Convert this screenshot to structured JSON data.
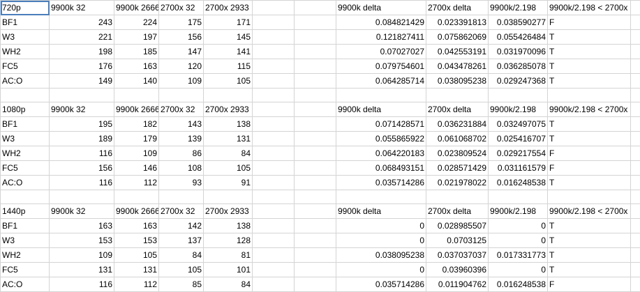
{
  "sheet": {
    "rows": [
      [
        "720p",
        "9900k 32",
        "9900k 2666",
        "2700x 32",
        "2700x 2933",
        "",
        "",
        "9900k delta",
        "2700x delta",
        "9900k/2.198",
        "9900k/2.198 < 2700x",
        ""
      ],
      [
        "BF1",
        "243",
        "224",
        "175",
        "171",
        "",
        "",
        "0.084821429",
        "0.023391813",
        "0.038590277",
        "F",
        ""
      ],
      [
        "W3",
        "221",
        "197",
        "156",
        "145",
        "",
        "",
        "0.121827411",
        "0.075862069",
        "0.055426484",
        "T",
        ""
      ],
      [
        "WH2",
        "198",
        "185",
        "147",
        "141",
        "",
        "",
        "0.07027027",
        "0.042553191",
        "0.031970096",
        "T",
        ""
      ],
      [
        "FC5",
        "176",
        "163",
        "120",
        "115",
        "",
        "",
        "0.079754601",
        "0.043478261",
        "0.036285078",
        "T",
        ""
      ],
      [
        "AC:O",
        "149",
        "140",
        "109",
        "105",
        "",
        "",
        "0.064285714",
        "0.038095238",
        "0.029247368",
        "T",
        ""
      ],
      [
        "",
        "",
        "",
        "",
        "",
        "",
        "",
        "",
        "",
        "",
        "",
        ""
      ],
      [
        "1080p",
        "9900k 32",
        "9900k 2666",
        "2700x 32",
        "2700x 2933",
        "",
        "",
        "9900k delta",
        "2700x delta",
        "9900k/2.198",
        "9900k/2.198 < 2700x",
        ""
      ],
      [
        "BF1",
        "195",
        "182",
        "143",
        "138",
        "",
        "",
        "0.071428571",
        "0.036231884",
        "0.032497075",
        "T",
        ""
      ],
      [
        "W3",
        "189",
        "179",
        "139",
        "131",
        "",
        "",
        "0.055865922",
        "0.061068702",
        "0.025416707",
        "T",
        ""
      ],
      [
        "WH2",
        "116",
        "109",
        "86",
        "84",
        "",
        "",
        "0.064220183",
        "0.023809524",
        "0.029217554",
        "F",
        ""
      ],
      [
        "FC5",
        "156",
        "146",
        "108",
        "105",
        "",
        "",
        "0.068493151",
        "0.028571429",
        "0.031161579",
        "F",
        ""
      ],
      [
        "AC:O",
        "116",
        "112",
        "93",
        "91",
        "",
        "",
        "0.035714286",
        "0.021978022",
        "0.016248538",
        "T",
        ""
      ],
      [
        "",
        "",
        "",
        "",
        "",
        "",
        "",
        "",
        "",
        "",
        "",
        ""
      ],
      [
        "1440p",
        "9900k 32",
        "9900k 2666",
        "2700x 32",
        "2700x 2933",
        "",
        "",
        "9900k delta",
        "2700x delta",
        "9900k/2.198",
        "9900k/2.198 < 2700x",
        ""
      ],
      [
        "BF1",
        "163",
        "163",
        "142",
        "138",
        "",
        "",
        "0",
        "0.028985507",
        "0",
        "T",
        ""
      ],
      [
        "W3",
        "153",
        "153",
        "137",
        "128",
        "",
        "",
        "0",
        "0.0703125",
        "0",
        "T",
        ""
      ],
      [
        "WH2",
        "109",
        "105",
        "84",
        "81",
        "",
        "",
        "0.038095238",
        "0.037037037",
        "0.017331773",
        "T",
        ""
      ],
      [
        "FC5",
        "131",
        "131",
        "105",
        "101",
        "",
        "",
        "0",
        "0.03960396",
        "0",
        "T",
        ""
      ],
      [
        "AC:O",
        "116",
        "112",
        "85",
        "84",
        "",
        "",
        "0.035714286",
        "0.011904762",
        "0.016248538",
        "F",
        ""
      ]
    ]
  }
}
